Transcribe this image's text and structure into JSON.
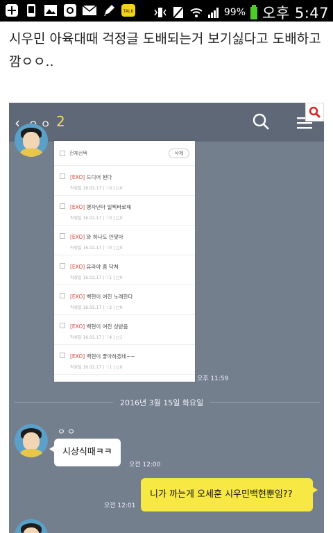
{
  "status_bar": {
    "battery_percent_text": "99%",
    "time": "오후 5:47"
  },
  "post": {
    "text": "시우민 아육대때 걱정글 도배되는거 보기싫다고 도배하고 깜ㅇㅇ.."
  },
  "chat": {
    "header": {
      "back_label": "‹",
      "title_masked": "ㅇㅇ",
      "member_count": "2"
    },
    "shared_screenshot": {
      "select_all": "전체선택",
      "delete": "삭제",
      "rows": [
        {
          "tag": "[EXO]",
          "title": "드디어 된다",
          "meta": "작성일 16.02.17 | ♡0 | □0"
        },
        {
          "tag": "[EXO]",
          "title": "명자년아 일찍바로해",
          "meta": "작성일 16.02.17 | ♡0 | □0"
        },
        {
          "tag": "[EXO]",
          "title": "와 하나도 안맞아",
          "meta": "작성일 16.02.17 | ♡0 | □0"
        },
        {
          "tag": "[EXO]",
          "title": "유라야 좀 닥쳐",
          "meta": "작성일 16.02.17 | ♡1 | □0"
        },
        {
          "tag": "[EXO]",
          "title": "백현이 여친 노래한다",
          "meta": "작성일 16.02.17 | ♡2 | □0"
        },
        {
          "tag": "[EXO]",
          "title": "백현이 여친 상받음",
          "meta": "작성일 16.02.17 | ♡4 | □1"
        },
        {
          "tag": "[EXO]",
          "title": "백현이 좋아하겠네~~",
          "meta": "작성일 16.02.17 | ♡1 | □0"
        }
      ]
    },
    "timestamp_1": "오후 11:59",
    "date_divider": "2016년 3월 15일 화요일",
    "sender_masked": "ㅇㅇ",
    "messages": [
      {
        "text": "시상식때ㅋㅋ",
        "time": "오전 12:00",
        "side": "left"
      },
      {
        "text": "니가 까는게 오세훈 시우민백현뿐임??",
        "time": "오전 12:01",
        "side": "right"
      }
    ]
  },
  "colors": {
    "chat_bg": "#747f8e",
    "header_bg": "#5f6877",
    "mine_bubble": "#f7e843",
    "accent_red": "#d9433c"
  }
}
